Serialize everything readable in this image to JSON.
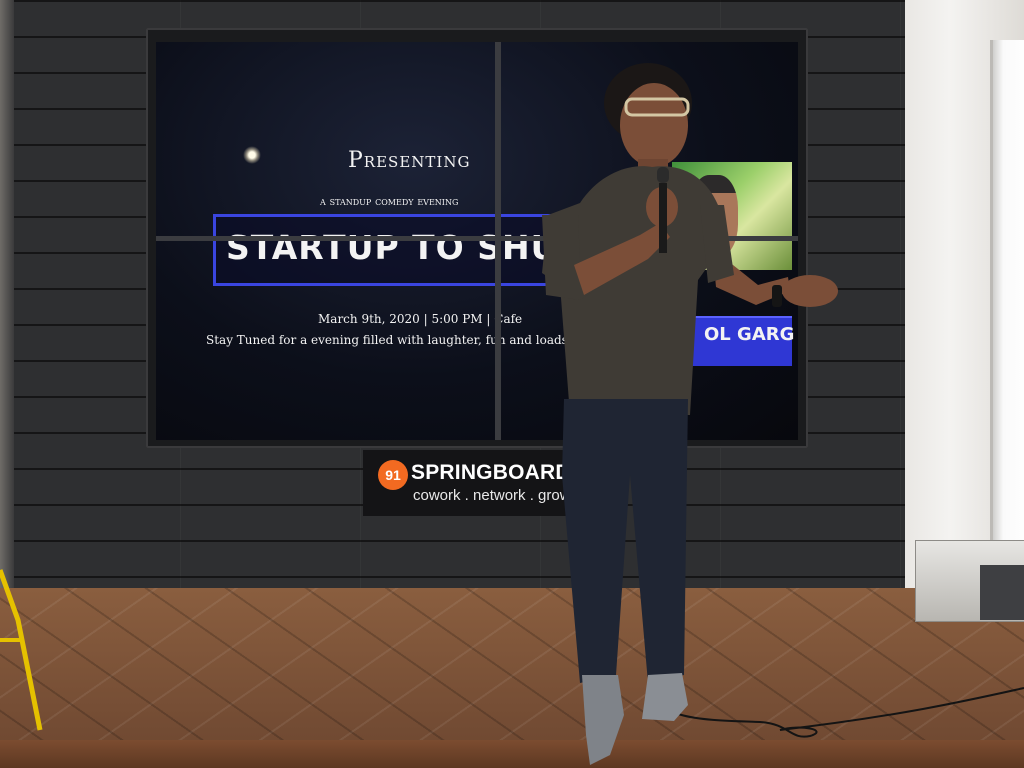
{
  "slide": {
    "presenting": "Presenting",
    "subtitle": "a standup comedy evening",
    "banner": "STARTUP TO SHUTDOWN",
    "date_line": "March 9th, 2020 | 5:00 PM | Cafe",
    "stay_tuned": "Stay Tuned for a evening filled with laughter, fun and loads of madness",
    "performer": "OL GARG"
  },
  "logo": {
    "number": "91",
    "name": "SPRINGBOARD",
    "tagline": "cowork . network . grow"
  },
  "colors": {
    "banner_border": "#3a45e0",
    "name_bar": "#2f37d4",
    "logo_orange": "#f26a21",
    "wall": "#2e2f31",
    "floor": "#7a5236"
  }
}
